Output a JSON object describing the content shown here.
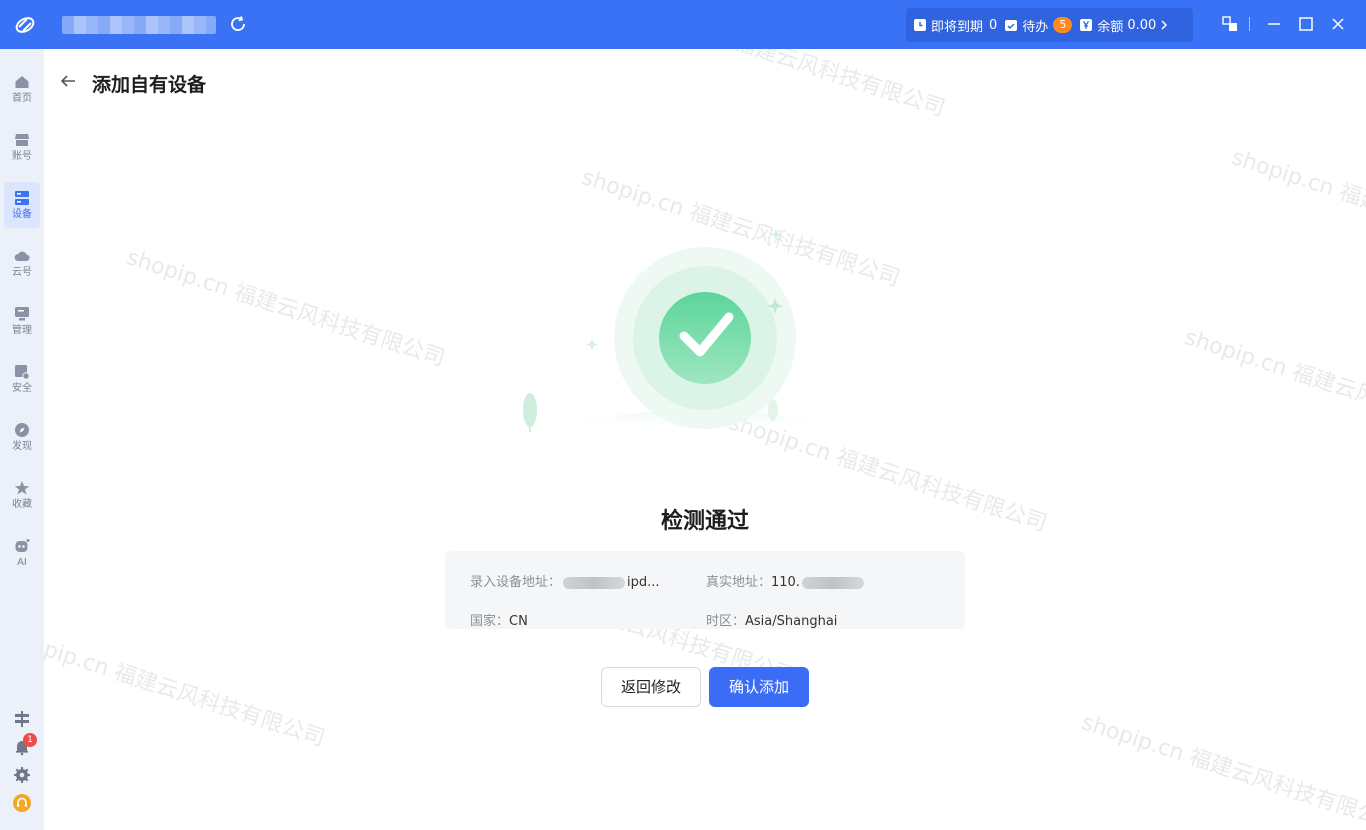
{
  "titlebar": {
    "status": {
      "expiring_label": "即将到期",
      "expiring_count": "0",
      "todo_label": "待办",
      "todo_count": "5",
      "balance_label": "余额",
      "balance_value": "0.00"
    }
  },
  "sidebar": {
    "items": [
      {
        "label": "首页",
        "icon": "home-icon"
      },
      {
        "label": "账号",
        "icon": "store-icon"
      },
      {
        "label": "设备",
        "icon": "server-icon",
        "active": true
      },
      {
        "label": "云号",
        "icon": "cloud-icon"
      },
      {
        "label": "管理",
        "icon": "monitor-icon"
      },
      {
        "label": "安全",
        "icon": "shield-icon"
      },
      {
        "label": "发现",
        "icon": "compass-icon"
      },
      {
        "label": "收藏",
        "icon": "star-icon"
      },
      {
        "label": "AI",
        "icon": "robot-icon"
      }
    ],
    "notification_count": "1"
  },
  "page": {
    "title": "添加自有设备",
    "result_title": "检测通过"
  },
  "info": {
    "device_address_label": "录入设备地址：",
    "device_address_prefix": "",
    "device_address_suffix": "ipd...",
    "real_address_label": "真实地址：",
    "real_address_prefix": "110.",
    "country_label": "国家：",
    "country_value": "CN",
    "timezone_label": "时区：",
    "timezone_value": "Asia/Shanghai"
  },
  "buttons": {
    "back_modify": "返回修改",
    "confirm_add": "确认添加"
  },
  "watermark": "shopip.cn 福建云风科技有限公司",
  "colors": {
    "accent": "#3a72f5",
    "success": "#2ec27e",
    "badge": "#ff8a1f"
  }
}
